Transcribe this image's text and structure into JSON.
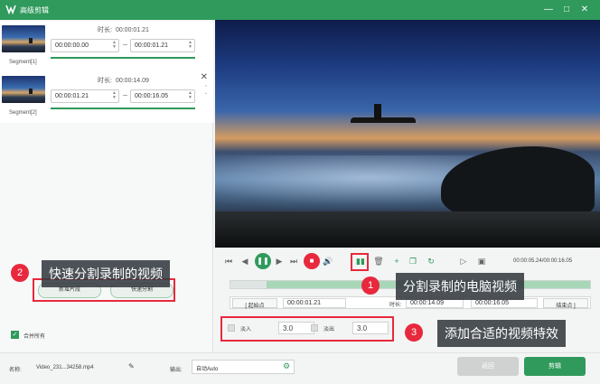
{
  "window": {
    "title": "高级剪辑"
  },
  "segments": [
    {
      "label": "Segment[1]",
      "duration_label": "时长:",
      "duration": "00:00:01.21",
      "start": "00:00:00.00",
      "end": "00:00:01.21",
      "progress": 1.0
    },
    {
      "label": "Segment[2]",
      "duration_label": "时长:",
      "duration": "00:00:14.09",
      "start": "00:00:01.21",
      "end": "00:00:16.05",
      "progress": 1.0
    }
  ],
  "left_buttons": {
    "new_clip": "新增片段",
    "quick_split": "快速分割"
  },
  "merge_all": {
    "label": "合并所有",
    "checked": true
  },
  "player": {
    "time_readout": "00:00:05.24/00:00:16.05",
    "start_point_btn": "起始点",
    "start_time": "00:00:01.21",
    "duration_label": "时长:",
    "duration_time": "00:00:14.09",
    "end_time": "00:00:16.05",
    "end_point_btn": "结束点",
    "track_fill_start": 0.1
  },
  "effects": {
    "fade_in_label": "淡入",
    "fade_in_value": "3.0",
    "fade_out_label": "淡出",
    "fade_out_value": "3.0"
  },
  "footer": {
    "name_label": "名称:",
    "name_value": "Video_231...34258.mp4",
    "output_label": "输出:",
    "output_value": "自动Auto",
    "back_btn": "返回",
    "cut_btn": "剪辑"
  },
  "annotations": {
    "one": "1",
    "one_text": "分割录制的电脑视频",
    "two": "2",
    "two_text": "快速分割录制的视频",
    "three": "3",
    "three_text": "添加合适的视频特效"
  },
  "colors": {
    "accent": "#2f9a5c",
    "annotation_red": "#e8293d",
    "play": "#2f9a5c",
    "stop": "#e8293d"
  },
  "icons": [
    "app-logo-icon",
    "minimize-icon",
    "maximize-icon",
    "close-icon",
    "skip-start-icon",
    "prev-frame-icon",
    "play-pause-icon",
    "next-frame-icon",
    "skip-end-icon",
    "stop-icon",
    "volume-icon",
    "split-icon",
    "delete-icon",
    "add-icon",
    "copy-icon",
    "rotate-icon",
    "crop-icon",
    "snapshot-icon",
    "edit-icon",
    "settings-icon"
  ]
}
